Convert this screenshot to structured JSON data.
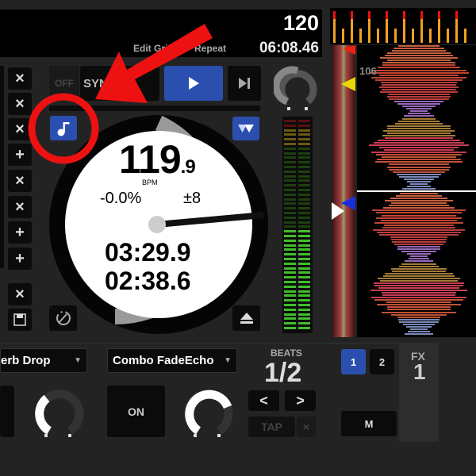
{
  "deck": {
    "bpm_header": "120",
    "remaining_header": "06:08.46",
    "edit_grid_label": "Edit Grid",
    "repeat_label": "Repeat",
    "sync_off_label": "OFF",
    "sync_label": "SYNC",
    "platter": {
      "bpm": "119.9",
      "bpm_unit": ".9",
      "bpm_main": "119",
      "bpm_label": "BPM",
      "pitch": "-0.0%",
      "range": "±8",
      "elapsed": "03:29.9",
      "remaining": "02:38.6"
    },
    "waveform_bpm": "106"
  },
  "cue_buttons": [
    "×",
    "×",
    "×",
    "+",
    "×",
    "×",
    "+",
    "+"
  ],
  "loop_buttons": [
    "×",
    "save"
  ],
  "fx": {
    "effect1": "erb Drop",
    "effect2": "Combo FadeEcho",
    "on_label": "ON",
    "beats_label": "BEATS",
    "beats_value": "1/2",
    "prev_label": "<",
    "next_label": ">",
    "tap_label": "TAP",
    "tap_clear": "×",
    "deck1": "1",
    "deck2": "2",
    "m_label": "M",
    "fx_label": "FX",
    "fx_number": "1"
  },
  "colors": {
    "accent": "#2a4fae",
    "annotation": "#ee1111",
    "meter_green": "#3fbf2a"
  }
}
